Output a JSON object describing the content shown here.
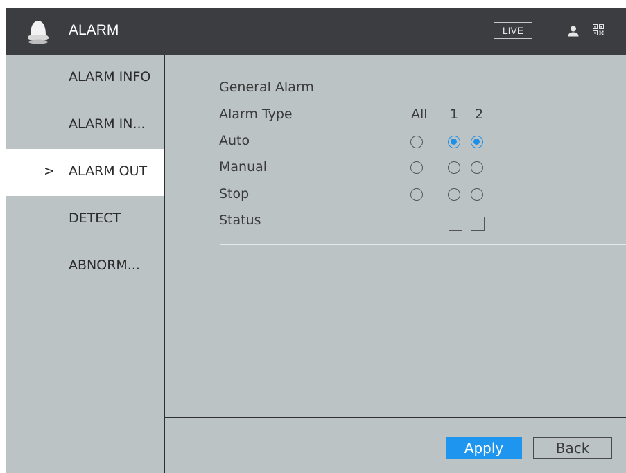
{
  "header": {
    "title": "ALARM",
    "live_label": "LIVE",
    "icons": [
      "alarm-bell-icon",
      "user-icon",
      "qr-code-icon"
    ]
  },
  "sidebar": {
    "items": [
      {
        "label": "ALARM INFO",
        "active": false
      },
      {
        "label": "ALARM IN...",
        "active": false
      },
      {
        "label": "ALARM OUT",
        "active": true,
        "marker": ">"
      },
      {
        "label": "DETECT",
        "active": false
      },
      {
        "label": "ABNORM...",
        "active": false
      }
    ]
  },
  "main": {
    "section_title": "General Alarm",
    "columns": [
      "All",
      "1",
      "2"
    ],
    "rows": [
      {
        "label": "Alarm Type"
      },
      {
        "label": "Auto",
        "selected": [
          "1",
          "2"
        ]
      },
      {
        "label": "Manual",
        "selected": []
      },
      {
        "label": "Stop",
        "selected": []
      },
      {
        "label": "Status",
        "checked": []
      }
    ]
  },
  "footer": {
    "apply_label": "Apply",
    "back_label": "Back"
  },
  "colors": {
    "header_bg": "#3b3d41",
    "panel_bg": "#bcc3c5",
    "accent": "#1e96f0"
  }
}
